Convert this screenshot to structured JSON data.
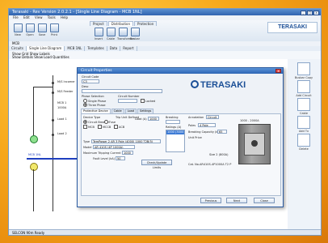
{
  "app": {
    "title": "Terasaki - Rev Version 2.0.2.1 - [Single Line Diagram - MCB 1NL]",
    "window_controls": [
      "_",
      "□",
      "x"
    ]
  },
  "menu": [
    "File",
    "Edit",
    "View",
    "Tools",
    "Help"
  ],
  "ribbon": {
    "tabs": [
      "Project",
      "Distribution",
      "Protection"
    ],
    "active_tab": "Distribution",
    "tools": [
      "New",
      "Open",
      "Save",
      "Print",
      "Insert",
      "Cable",
      "Transformer",
      "Busbar"
    ],
    "logo_text": "TERASAKI"
  },
  "project_bar": {
    "name": "MCB"
  },
  "doc_tabs": [
    "Circuits",
    "Single Line Diagram",
    "MCB 1NL",
    "Templates",
    "Data",
    "Report"
  ],
  "doc_tab_active": "Single Line Diagram",
  "view_bar": {
    "line1": "Show Grid   Show Labels",
    "line2": "Show Details   Show Load Quantities"
  },
  "canvas": {
    "labels": {
      "main_supply": "M/S Incomer",
      "feeder": "M/S Feeder",
      "mcb_label": "MCB 1",
      "breaker_label": "1000A",
      "load1": "Load 1",
      "load2": "Load 2",
      "busbar_label": "MCB 1NL"
    }
  },
  "right_panel": {
    "items": [
      "Busbar Copy",
      "Add Circuit",
      "Cable",
      "Add Tx",
      "Delete"
    ]
  },
  "status": {
    "text": "SELCON 90m  Ready"
  },
  "dialog": {
    "title": "Circuit Properties",
    "circuit_code_label": "Circuit Code",
    "circuit_code_value": "C3",
    "description_label": "Desc",
    "phase_selection_label": "Phase Selection",
    "single_phase": "Single Phase",
    "three_phase": "Three Phase",
    "circuit_number_label": "Circuit Number",
    "locked_label": "Locked",
    "logo_text": "TERASAKI",
    "tabs": [
      "Protective Device",
      "Cable",
      "Load",
      "Settings"
    ],
    "active_tab": "Protective Device",
    "device_type_label": "Device Type",
    "device_types": [
      "Circuit Breaker",
      "Fuse"
    ],
    "trip_unit_label": "Trip Unit Defined",
    "options": [
      "MCB",
      "MCCB",
      "ACB"
    ],
    "load_label": "Load (A)",
    "load_value": "1000",
    "breaking_label": "Breaking",
    "type_label": "Type",
    "type_value": "TemPower 2 AR 3 Pole (4000) 1000 T2B(5)",
    "model_label": "Model",
    "model_value": "AR 410S (4P 1000A)",
    "max_ta_label": "Maximum Tripping Current In (A)",
    "max_ta_value": "1000",
    "fault_level_label": "Fault Level (kA)",
    "fault_level_value": "50",
    "settings_button": "Check/Update Limits",
    "ratings_label": "Ratings (A)",
    "ratings_selected": "1000 (3000 A)",
    "annotation_label": "Annotation",
    "annotation_value": "Circuit",
    "pole_label": "Poles",
    "pole_value": "4 Pole",
    "breaking_cap_label": "Breaking Capacity (kA)",
    "breaking_cap_value": "65",
    "device_frame": "1000 - 2000A",
    "frame_legend": "Size 2 (800A)",
    "cat_label": "Cat. No.",
    "cat_value": "AR410S-4P1000A T2 P",
    "unit_price": "Unit Price",
    "buttons": [
      "Previous",
      "Next",
      "Close"
    ]
  }
}
